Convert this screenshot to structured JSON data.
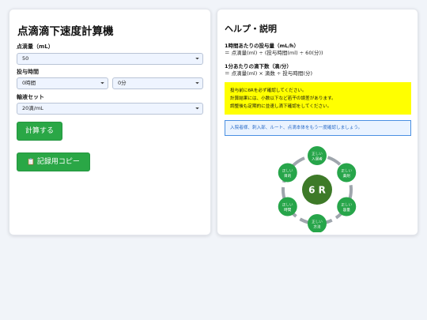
{
  "calc": {
    "title": "点滴滴下速度計算機",
    "volume_label": "点滴量（mL）",
    "volume_value": "50",
    "time_label": "投与時間",
    "hours_value": "0時間",
    "minutes_value": "0分",
    "set_label": "輸液セット",
    "set_value": "20滴/mL",
    "calc_button": "計算する",
    "copy_icon": "clipboard-icon",
    "copy_button": "記録用コピー"
  },
  "help": {
    "title": "ヘルプ・説明",
    "formula1_heading": "1時間あたりの投与量（mL/h）",
    "formula1_text": "＝ 点滴量(ml) ÷ (投与時間(ml) ÷ 60(分))",
    "formula2_heading": "1分あたりの滴下数（滴/分）",
    "formula2_text": "＝ 点滴量(ml) × 滴数 ÷ 投与時間(分)",
    "warning_lines": [
      "投与前に6Rを必ず確認してください。",
      "計算結果には、小数以下など若干の誤差があります。",
      "調整後も定期的に並速し滴下確認をしてください。"
    ],
    "confirm_text": "入院者様、刺入部、ルート、点滴本体をもう一度確認しましょう。"
  },
  "diagram": {
    "center": "6 R",
    "nodes": [
      {
        "top": "正しい",
        "bottom": "入居者"
      },
      {
        "top": "正しい",
        "bottom": "薬剤"
      },
      {
        "top": "正しい",
        "bottom": "容量"
      },
      {
        "top": "正しい",
        "bottom": "方法"
      },
      {
        "top": "正しい",
        "bottom": "時間"
      },
      {
        "top": "正しい",
        "bottom": "目的"
      }
    ],
    "colors": {
      "center": "#3d7a28",
      "node": "#27a54a",
      "ring": "#9fa6ad"
    }
  }
}
